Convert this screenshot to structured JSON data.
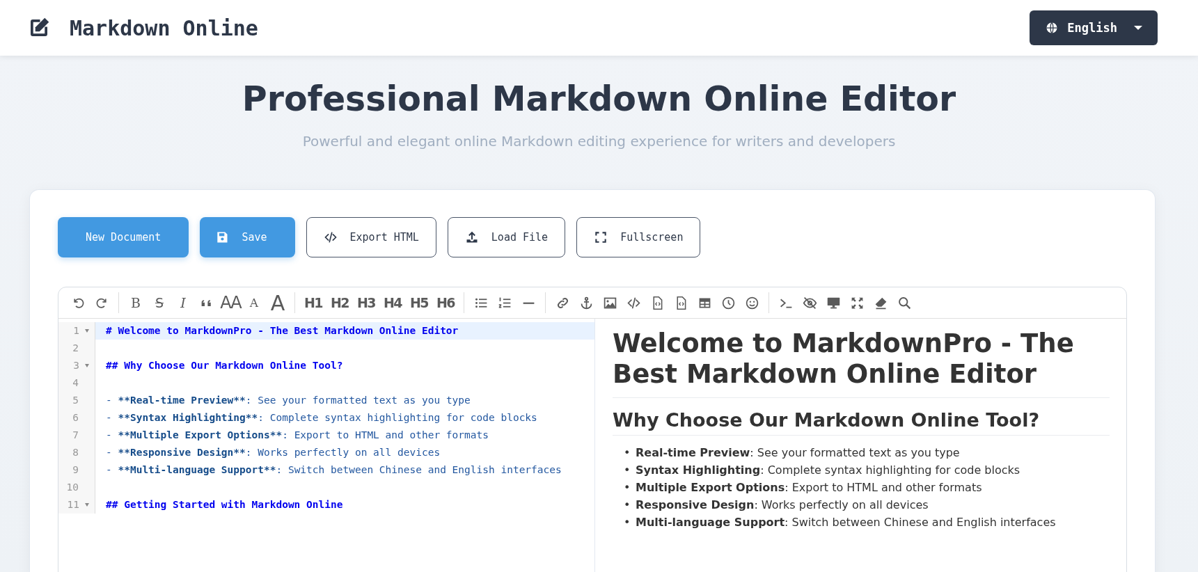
{
  "header": {
    "title": "Markdown Online",
    "language": "English"
  },
  "hero": {
    "title": "Professional Markdown Online Editor",
    "subtitle": "Powerful and elegant online Markdown editing experience for writers and developers"
  },
  "actions": [
    {
      "label": "New Document",
      "kind": "primary"
    },
    {
      "label": "Save",
      "kind": "primary"
    },
    {
      "label": "Export HTML",
      "kind": "outline"
    },
    {
      "label": "Load File",
      "kind": "outline"
    },
    {
      "label": "Fullscreen",
      "kind": "outline"
    }
  ],
  "toolbar": [
    [
      {
        "kind": "undo"
      },
      {
        "kind": "redo"
      }
    ],
    [
      {
        "kind": "bold",
        "text": "B"
      },
      {
        "kind": "strike",
        "text": "S"
      },
      {
        "kind": "italic",
        "text": "I"
      },
      {
        "kind": "quote"
      },
      {
        "kind": "big",
        "text": "AA"
      },
      {
        "kind": "small",
        "text": "A"
      },
      {
        "kind": "large",
        "text": "A"
      }
    ],
    [
      {
        "kind": "heading",
        "text": "H1"
      },
      {
        "kind": "heading",
        "text": "H2"
      },
      {
        "kind": "heading",
        "text": "H3"
      },
      {
        "kind": "heading",
        "text": "H4"
      },
      {
        "kind": "heading",
        "text": "H5"
      },
      {
        "kind": "heading",
        "text": "H6"
      }
    ],
    [
      {
        "kind": "bullets"
      },
      {
        "kind": "numbers"
      },
      {
        "kind": "rule"
      }
    ],
    [
      {
        "kind": "link"
      },
      {
        "kind": "anchor"
      },
      {
        "kind": "image"
      },
      {
        "kind": "code"
      },
      {
        "kind": "codefile"
      },
      {
        "kind": "codefile"
      },
      {
        "kind": "table"
      },
      {
        "kind": "clock"
      },
      {
        "kind": "smiley"
      }
    ],
    [
      {
        "kind": "terminal"
      },
      {
        "kind": "eyeslash"
      },
      {
        "kind": "monitor"
      },
      {
        "kind": "arrows"
      },
      {
        "kind": "eraser"
      },
      {
        "kind": "search"
      }
    ]
  ],
  "source_lines": [
    {
      "number": "1",
      "foldable": true,
      "active": true,
      "parts": [
        {
          "kind": "header",
          "text": "# Welcome to MarkdownPro - The Best Markdown Online Editor"
        }
      ]
    },
    {
      "number": "2",
      "foldable": false,
      "active": false
    },
    {
      "number": "3",
      "foldable": true,
      "active": false,
      "parts": [
        {
          "kind": "header",
          "text": "## Why Choose Our Markdown Online Tool?"
        }
      ]
    },
    {
      "number": "4",
      "foldable": false,
      "active": false
    },
    {
      "number": "5",
      "foldable": false,
      "active": false,
      "parts": [
        {
          "kind": "plain",
          "text": "- "
        },
        {
          "kind": "strong",
          "text": "**Real-time Preview**"
        },
        {
          "kind": "plain",
          "text": ": See your formatted text as you type"
        }
      ]
    },
    {
      "number": "6",
      "foldable": false,
      "active": false,
      "parts": [
        {
          "kind": "plain",
          "text": "- "
        },
        {
          "kind": "strong",
          "text": "**Syntax Highlighting**"
        },
        {
          "kind": "plain",
          "text": ": Complete syntax highlighting for code blocks"
        }
      ]
    },
    {
      "number": "7",
      "foldable": false,
      "active": false,
      "parts": [
        {
          "kind": "plain",
          "text": "- "
        },
        {
          "kind": "strong",
          "text": "**Multiple Export Options**"
        },
        {
          "kind": "plain",
          "text": ": Export to HTML and other formats"
        }
      ]
    },
    {
      "number": "8",
      "foldable": false,
      "active": false,
      "parts": [
        {
          "kind": "plain",
          "text": "- "
        },
        {
          "kind": "strong",
          "text": "**Responsive Design**"
        },
        {
          "kind": "plain",
          "text": ": Works perfectly on all devices"
        }
      ]
    },
    {
      "number": "9",
      "foldable": false,
      "active": false,
      "parts": [
        {
          "kind": "plain",
          "text": "- "
        },
        {
          "kind": "strong",
          "text": "**Multi-language Support**"
        },
        {
          "kind": "plain",
          "text": ": Switch between Chinese and English interfaces"
        }
      ]
    },
    {
      "number": "10",
      "foldable": false,
      "active": false
    },
    {
      "number": "11",
      "foldable": true,
      "active": false,
      "parts": [
        {
          "kind": "header",
          "text": "## Getting Started with Markdown Online"
        }
      ]
    }
  ],
  "preview": {
    "h1": "Welcome to MarkdownPro - The Best Markdown Online Editor",
    "h2": "Why Choose Our Markdown Online Tool?",
    "items": [
      {
        "marker": "•",
        "text": "**Real-time Preview**: See your formatted text as you type"
      },
      {
        "marker": "•",
        "text": "**Syntax Highlighting**: Complete syntax highlighting for code blocks"
      },
      {
        "marker": "•",
        "text": "**Multiple Export Options**: Export to HTML and other formats"
      },
      {
        "marker": "•",
        "text": "**Responsive Design**: Works perfectly on all devices"
      },
      {
        "marker": "•",
        "text": "**Multi-language Support**: Switch between Chinese and English interfaces"
      }
    ]
  }
}
